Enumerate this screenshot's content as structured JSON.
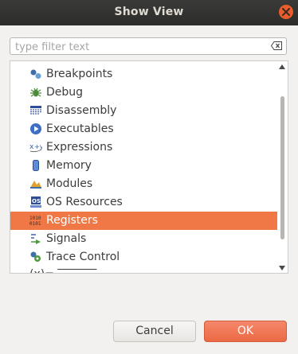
{
  "window": {
    "title": "Show View"
  },
  "filter": {
    "placeholder": "type filter text",
    "value": "",
    "clear_icon": "clear-text-icon"
  },
  "list": {
    "items": [
      {
        "label": "Breakpoints",
        "icon": "breakpoints-icon",
        "selected": false
      },
      {
        "label": "Debug",
        "icon": "debug-icon",
        "selected": false
      },
      {
        "label": "Disassembly",
        "icon": "disassembly-icon",
        "selected": false
      },
      {
        "label": "Executables",
        "icon": "executables-icon",
        "selected": false
      },
      {
        "label": "Expressions",
        "icon": "expressions-icon",
        "selected": false
      },
      {
        "label": "Memory",
        "icon": "memory-icon",
        "selected": false
      },
      {
        "label": "Modules",
        "icon": "modules-icon",
        "selected": false
      },
      {
        "label": "OS Resources",
        "icon": "os-resources-icon",
        "selected": false
      },
      {
        "label": "Registers",
        "icon": "registers-icon",
        "selected": true
      },
      {
        "label": "Signals",
        "icon": "signals-icon",
        "selected": false
      },
      {
        "label": "Trace Control",
        "icon": "trace-control-icon",
        "selected": false
      }
    ],
    "selected_color": "#f07746"
  },
  "buttons": {
    "cancel": "Cancel",
    "ok": "OK"
  },
  "colors": {
    "titlebar": "#2f2f2d",
    "accent": "#ec6a45"
  }
}
